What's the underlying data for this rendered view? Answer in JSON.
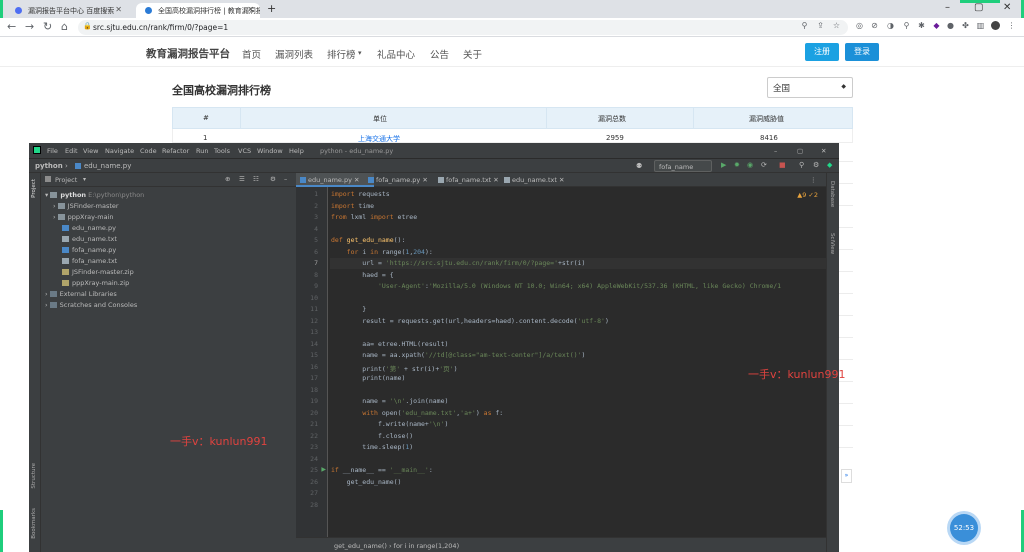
{
  "browser": {
    "tabs": [
      {
        "title": "漏洞报告平台中心 百度搜索",
        "active": false
      },
      {
        "title": "全国高校漏洞排行榜 | 教育漏洞报",
        "active": true
      }
    ],
    "new_tab": "+",
    "url": "src.sjtu.edu.cn/rank/firm/0/?page=1",
    "window_controls": {
      "minimize": "–",
      "maximize": "▢",
      "close": "✕"
    }
  },
  "site": {
    "brand": "教育漏洞报告平台",
    "nav": [
      "首页",
      "漏洞列表",
      "排行榜",
      "礼品中心",
      "公告",
      "关于"
    ],
    "rank_caret": "▾",
    "register_label": "注册",
    "login_label": "登录",
    "page_title": "全国高校漏洞排行榜",
    "region_select": "全国",
    "table_headers": [
      "#",
      "单位",
      "漏洞总数",
      "漏洞威胁值"
    ],
    "rows": [
      {
        "rank": "1",
        "unit": "上海交通大学",
        "total": "2959",
        "threat": "8416"
      }
    ],
    "pager_next": "»",
    "accent_color": "#1ba1e2"
  },
  "ide": {
    "menu": [
      "File",
      "Edit",
      "View",
      "Navigate",
      "Code",
      "Refactor",
      "Run",
      "Tools",
      "VCS",
      "Window",
      "Help"
    ],
    "window_title": "python - edu_name.py",
    "breadcrumb_project": "python",
    "breadcrumb_file": "edu_name.py",
    "run_config": "fofa_name",
    "project_header": "Project",
    "tree": [
      {
        "label": "python",
        "suffix": "E:\\python\\python",
        "kind": "folder-open"
      },
      {
        "label": "JSFinder-master",
        "kind": "folder"
      },
      {
        "label": "pppXray-main",
        "kind": "folder"
      },
      {
        "label": "edu_name.py",
        "kind": "py"
      },
      {
        "label": "edu_name.txt",
        "kind": "txt"
      },
      {
        "label": "fofa_name.py",
        "kind": "py"
      },
      {
        "label": "fofa_name.txt",
        "kind": "txt"
      },
      {
        "label": "JSFinder-master.zip",
        "kind": "zip"
      },
      {
        "label": "pppXray-main.zip",
        "kind": "zip"
      },
      {
        "label": "External Libraries",
        "kind": "lib"
      },
      {
        "label": "Scratches and Consoles",
        "kind": "scratch"
      }
    ],
    "editor_tabs": [
      "edu_name.py",
      "fofa_name.py",
      "fofa_name.txt",
      "edu_name.txt"
    ],
    "inspections": "▲9 ✓2",
    "left_tool_labels": [
      "Project",
      "Structure",
      "Bookmarks"
    ],
    "right_tool_labels": [
      "Database",
      "SciView"
    ],
    "line_numbers": [
      "1",
      "2",
      "3",
      "4",
      "5",
      "6",
      "7",
      "8",
      "9",
      "10",
      "11",
      "12",
      "13",
      "14",
      "15",
      "16",
      "17",
      "18",
      "19",
      "20",
      "21",
      "22",
      "23",
      "24",
      "25",
      "26",
      "27",
      "28"
    ],
    "status_breadcrumb": "get_edu_name()  ›  for i in range(1,204)"
  },
  "watermarks": {
    "left": "一手v：kunlun991",
    "right": "一手v：kunlun991"
  },
  "clock": "52:53"
}
